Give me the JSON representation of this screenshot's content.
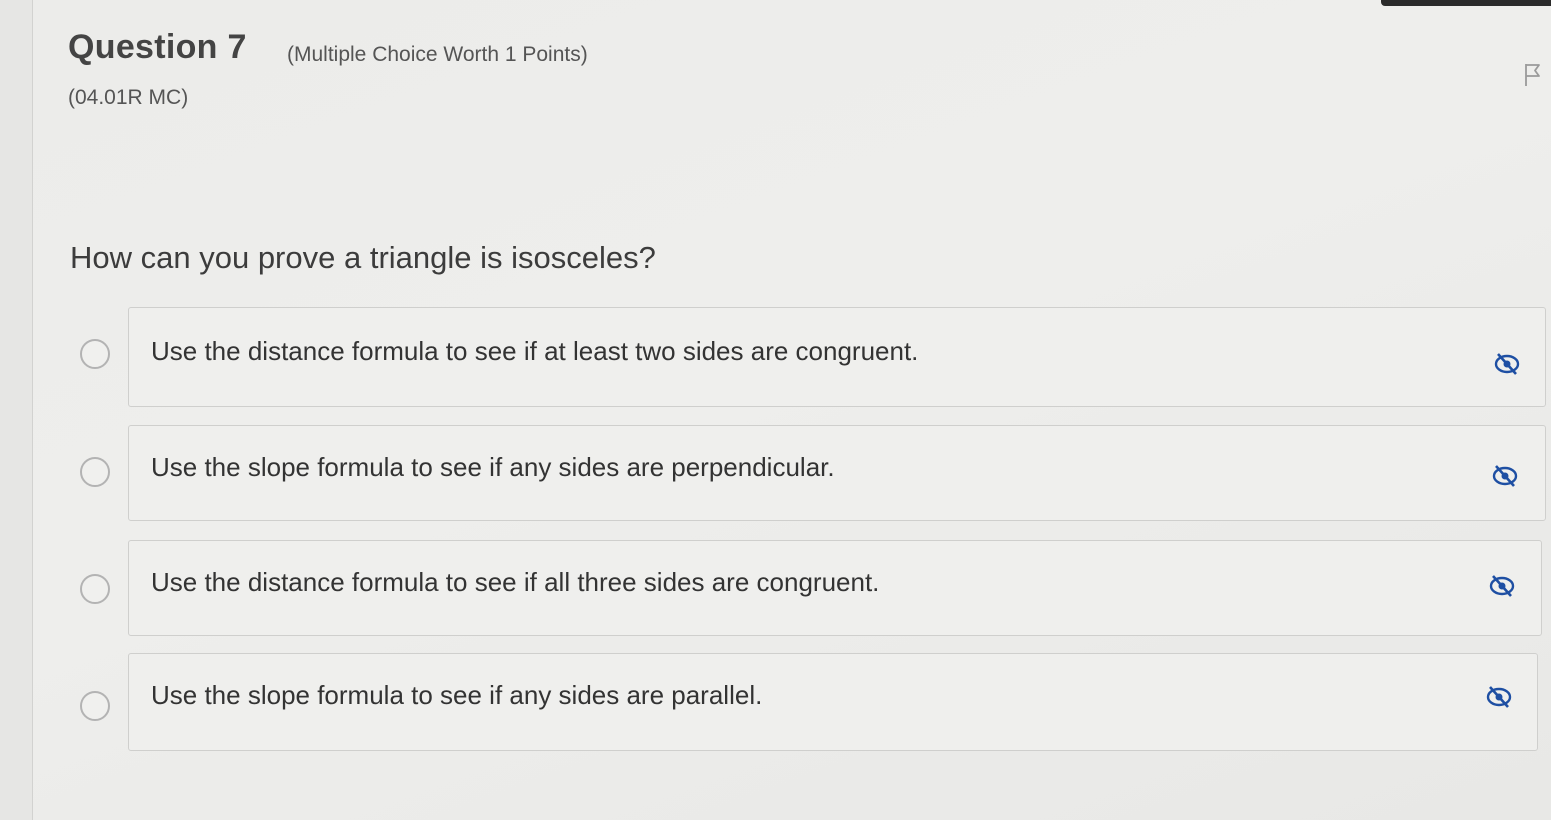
{
  "question": {
    "title": "Question 7",
    "meta": "(Multiple Choice Worth 1 Points)",
    "code": "(04.01R MC)",
    "prompt": "How can you prove a triangle is isosceles?",
    "flag_icon": "flag-icon"
  },
  "choices": [
    {
      "text": "Use the distance formula to see if at least two sides are congruent.",
      "selected": false,
      "eliminate_icon": "eye-slash-icon"
    },
    {
      "text": "Use the slope formula to see if any sides are perpendicular.",
      "selected": false,
      "eliminate_icon": "eye-slash-icon"
    },
    {
      "text": "Use the distance formula to see if all three sides are congruent.",
      "selected": false,
      "eliminate_icon": "eye-slash-icon"
    },
    {
      "text": "Use the slope formula to see if any sides are parallel.",
      "selected": false,
      "eliminate_icon": "eye-slash-icon"
    }
  ],
  "colors": {
    "background": "#ececea",
    "eliminate_icon": "#1e4fa3",
    "radio_border": "#b3b3b3"
  }
}
